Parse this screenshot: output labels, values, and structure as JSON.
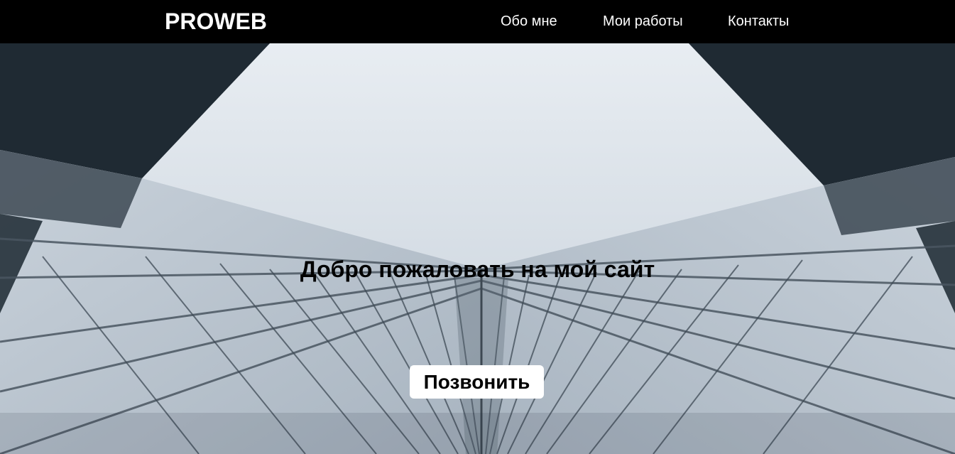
{
  "header": {
    "logo": "PROWEB",
    "nav": [
      {
        "label": "Обо мне"
      },
      {
        "label": "Мои работы"
      },
      {
        "label": "Контакты"
      }
    ]
  },
  "hero": {
    "title": "Добро пожаловать на мой сайт",
    "button_label": "Позвонить"
  }
}
